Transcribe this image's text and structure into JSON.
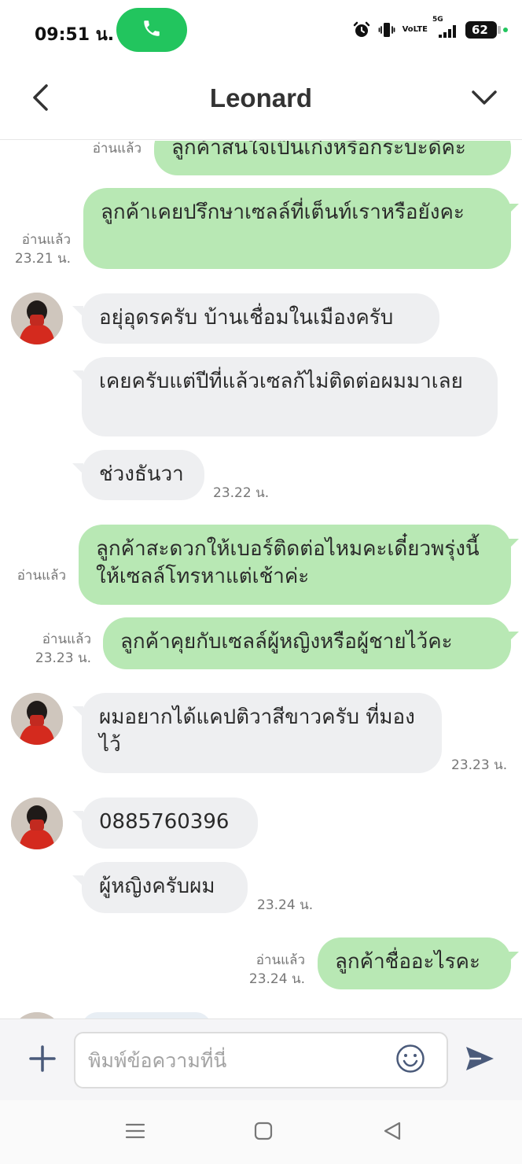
{
  "status_bar": {
    "time": "09:51 น.",
    "battery": "62",
    "network": "5G",
    "volte_top": "Vo",
    "volte_bottom": "LTE",
    "call_color": "#22c55e",
    "icons": [
      "phone-icon",
      "alarm-icon",
      "vibrate-icon",
      "signal-icon",
      "battery-icon"
    ]
  },
  "header": {
    "title": "Leonard",
    "back_icon": "chevron-left-icon",
    "menu_icon": "chevron-down-icon"
  },
  "messages": [
    {
      "dir": "out",
      "text": "ลูกค้าสนใจเป็นเก๋งหรือกระบะดีคะ",
      "read": "อ่านแล้ว",
      "time": ""
    },
    {
      "dir": "out",
      "text": "ลูกค้าเคยปรึกษาเซลล์ที่เต็นท์เราหรือยังคะ",
      "read": "อ่านแล้ว",
      "time": "23.21 น."
    },
    {
      "dir": "in",
      "text": "อยุ่อุดรครับ  บ้านเชื่อมในเมืองครับ",
      "time": ""
    },
    {
      "dir": "in",
      "text": "เคยครับแต่ปีที่แล้วเซลก้ไม่ติดต่อผมมาเลย",
      "time": ""
    },
    {
      "dir": "in",
      "text": "ช่วงธันวา",
      "time": "23.22 น."
    },
    {
      "dir": "out",
      "text": "ลูกค้าสะดวกให้เบอร์ติดต่อไหมคะเดี๋ยวพรุ่งนี้ให้เซลล์โทรหาแต่เช้าค่ะ",
      "read": "อ่านแล้ว",
      "time": ""
    },
    {
      "dir": "out",
      "text": "ลูกค้าคุยกับเซลล์ผู้หญิงหรือผู้ชายไว้คะ",
      "read": "อ่านแล้ว",
      "time": "23.23 น."
    },
    {
      "dir": "in",
      "text": "ผมอยากได้แคปติวาสีขาวครับ  ที่มองไว้",
      "time": "23.23 น."
    },
    {
      "dir": "in",
      "text": "0885760396",
      "time": ""
    },
    {
      "dir": "in",
      "text": "ผู้หญิงครับผม",
      "time": "23.24 น."
    },
    {
      "dir": "out",
      "text": "ลูกค้าชื่ออะไรคะ",
      "read": "อ่านแล้ว",
      "time": "23.24 น."
    }
  ],
  "input": {
    "placeholder": "พิมพ์ข้อความที่นี่",
    "plus_icon": "plus-icon",
    "emoji_icon": "smiley-icon",
    "send_icon": "send-icon"
  },
  "nav": {
    "icons": [
      "recent-apps-icon",
      "home-icon",
      "back-triangle-icon"
    ]
  },
  "colors": {
    "outgoing_bubble": "#b8e8b4",
    "incoming_bubble": "#eeeff1",
    "send_icon": "#4a5a7a"
  }
}
